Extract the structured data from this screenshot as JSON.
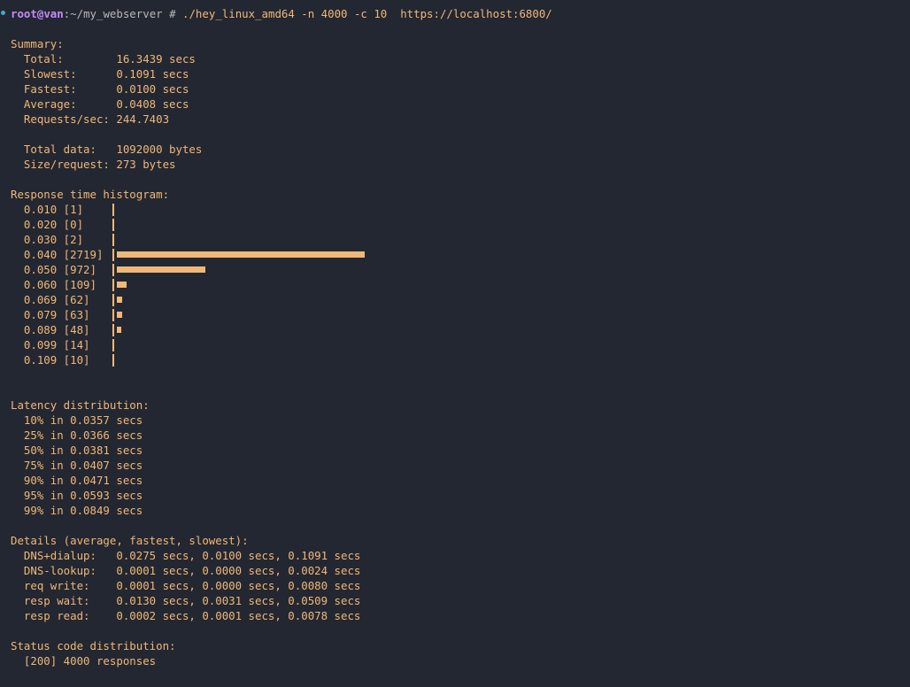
{
  "prompt": {
    "user": "root",
    "at": "@",
    "host": "van",
    "colon": ":",
    "path": "~/my_webserver",
    "symbol": "#",
    "command": "./hey_linux_amd64 -n 4000 -c 10  https://localhost:6800/"
  },
  "summary": {
    "heading": "Summary:",
    "rows": [
      "  Total:        16.3439 secs",
      "  Slowest:      0.1091 secs",
      "  Fastest:      0.0100 secs",
      "  Average:      0.0408 secs",
      "  Requests/sec: 244.7403",
      "",
      "  Total data:   1092000 bytes",
      "  Size/request: 273 bytes"
    ]
  },
  "histogram": {
    "heading": "Response time histogram:",
    "rows": [
      {
        "label": "  0.010 [1]",
        "count": 1
      },
      {
        "label": "  0.020 [0]",
        "count": 0
      },
      {
        "label": "  0.030 [2]",
        "count": 2
      },
      {
        "label": "  0.040 [2719]",
        "count": 2719
      },
      {
        "label": "  0.050 [972]",
        "count": 972
      },
      {
        "label": "  0.060 [109]",
        "count": 109
      },
      {
        "label": "  0.069 [62]",
        "count": 62
      },
      {
        "label": "  0.079 [63]",
        "count": 63
      },
      {
        "label": "  0.089 [48]",
        "count": 48
      },
      {
        "label": "  0.099 [14]",
        "count": 14
      },
      {
        "label": "  0.109 [10]",
        "count": 10
      }
    ]
  },
  "latency": {
    "heading": "Latency distribution:",
    "rows": [
      "  10% in 0.0357 secs",
      "  25% in 0.0366 secs",
      "  50% in 0.0381 secs",
      "  75% in 0.0407 secs",
      "  90% in 0.0471 secs",
      "  95% in 0.0593 secs",
      "  99% in 0.0849 secs"
    ]
  },
  "details": {
    "heading": "Details (average, fastest, slowest):",
    "rows": [
      "  DNS+dialup:   0.0275 secs, 0.0100 secs, 0.1091 secs",
      "  DNS-lookup:   0.0001 secs, 0.0000 secs, 0.0024 secs",
      "  req write:    0.0001 secs, 0.0000 secs, 0.0080 secs",
      "  resp wait:    0.0130 secs, 0.0031 secs, 0.0509 secs",
      "  resp read:    0.0002 secs, 0.0001 secs, 0.0078 secs"
    ]
  },
  "status": {
    "heading": "Status code distribution:",
    "rows": [
      "  [200] 4000 responses"
    ]
  }
}
